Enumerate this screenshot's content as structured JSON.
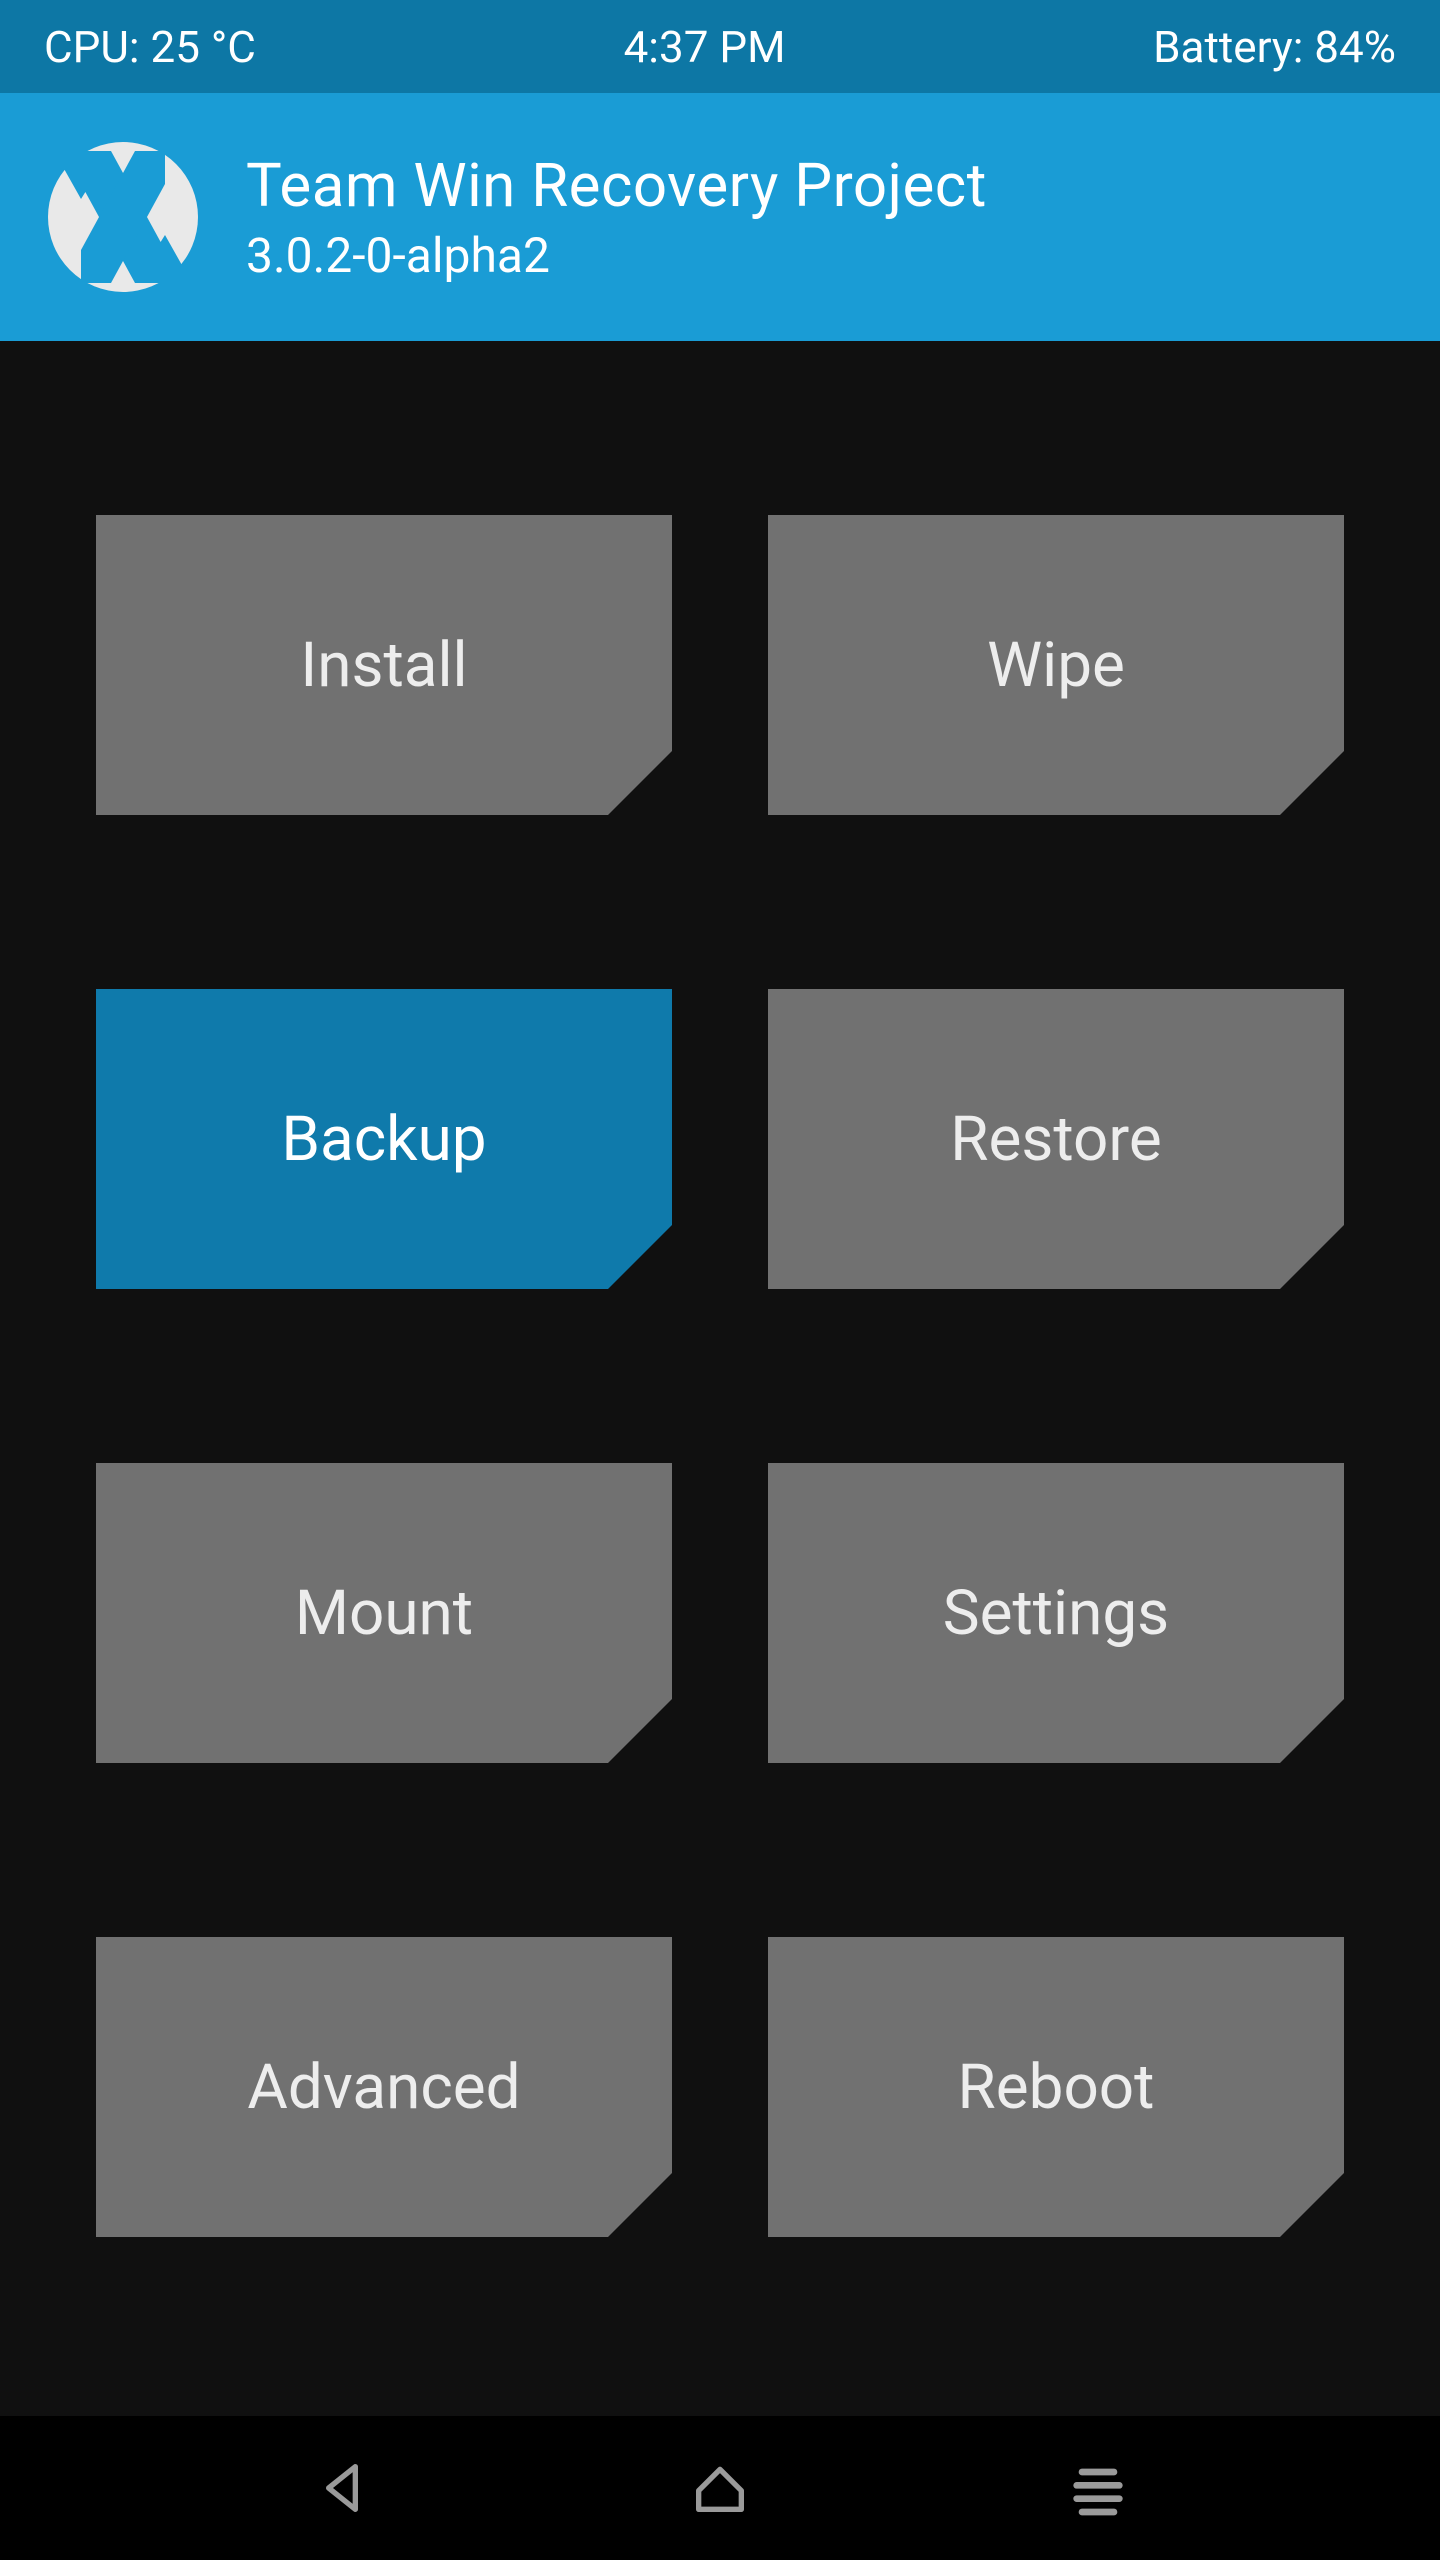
{
  "status": {
    "cpu": "CPU: 25 °C",
    "time": "4:37 PM",
    "battery": "Battery: 84%"
  },
  "header": {
    "title": "Team Win Recovery Project",
    "version": "3.0.2-0-alpha2"
  },
  "buttons": [
    {
      "label": "Install",
      "active": false
    },
    {
      "label": "Wipe",
      "active": false
    },
    {
      "label": "Backup",
      "active": true
    },
    {
      "label": "Restore",
      "active": false
    },
    {
      "label": "Mount",
      "active": false
    },
    {
      "label": "Settings",
      "active": false
    },
    {
      "label": "Advanced",
      "active": false
    },
    {
      "label": "Reboot",
      "active": false
    }
  ],
  "colors": {
    "status_bg": "#0d77a5",
    "header_bg": "#1a9cd5",
    "button_bg": "#717171",
    "button_active_bg": "#0f7aab",
    "page_bg": "#101010"
  }
}
